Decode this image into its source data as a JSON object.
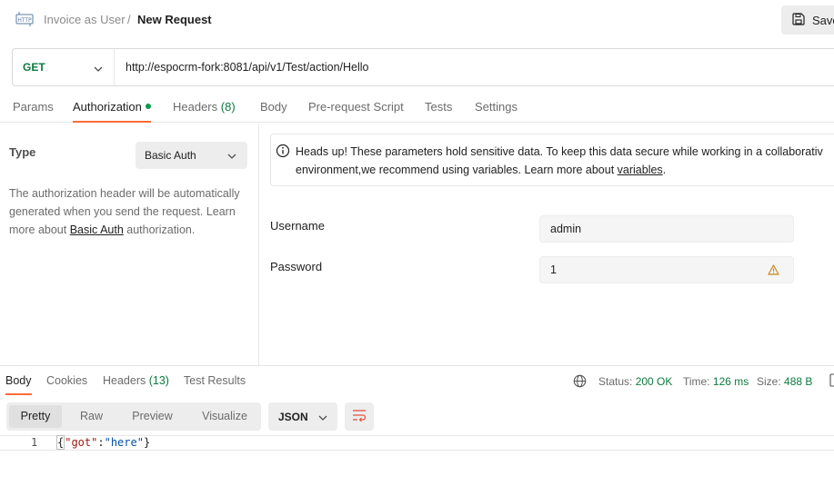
{
  "header": {
    "icon": "http-icon",
    "breadcrumb_parent": "Invoice as User",
    "breadcrumb_sep": "/",
    "breadcrumb_current": "New Request",
    "save_label": "Save"
  },
  "request": {
    "method": "GET",
    "url": "http://espocrm-fork:8081/api/v1/Test/action/Hello"
  },
  "request_tabs": [
    {
      "label": "Params"
    },
    {
      "label": "Authorization",
      "indicator": true
    },
    {
      "label": "Headers",
      "count": "(8)"
    },
    {
      "label": "Body"
    },
    {
      "label": "Pre-request Script"
    },
    {
      "label": "Tests"
    },
    {
      "label": "Settings"
    }
  ],
  "auth": {
    "type_label": "Type",
    "type_value": "Basic Auth",
    "desc_1": "The authorization header will be automatically",
    "desc_2": "generated when you send the request. Learn",
    "desc_3_pre": "more about ",
    "desc_3_link": "Basic Auth",
    "desc_3_post": " authorization.",
    "notice_line_1": "Heads up! These parameters hold sensitive data. To keep this data secure while working in a collaborativ",
    "notice_line_2_pre": "environment,we recommend using variables. Learn more about ",
    "notice_line_2_link": "variables",
    "notice_line_2_post": ".",
    "username_label": "Username",
    "username_value": "admin",
    "password_label": "Password",
    "password_value": "1"
  },
  "response": {
    "tabs": [
      {
        "label": "Body"
      },
      {
        "label": "Cookies"
      },
      {
        "label": "Headers",
        "count": "(13)"
      },
      {
        "label": "Test Results"
      }
    ],
    "status_label": "Status:",
    "status_value": "200 OK",
    "time_label": "Time:",
    "time_value": "126 ms",
    "size_label": "Size:",
    "size_value": "488 B",
    "view_options": [
      "Pretty",
      "Raw",
      "Preview",
      "Visualize"
    ],
    "format": "JSON",
    "line_number": "1",
    "code_open": "{",
    "code_key": "\"got\"",
    "code_colon": ":",
    "code_value": "\"here\"",
    "code_close": "}"
  },
  "colors": {
    "accent": "#ff6c37",
    "success": "#0b7a40"
  }
}
